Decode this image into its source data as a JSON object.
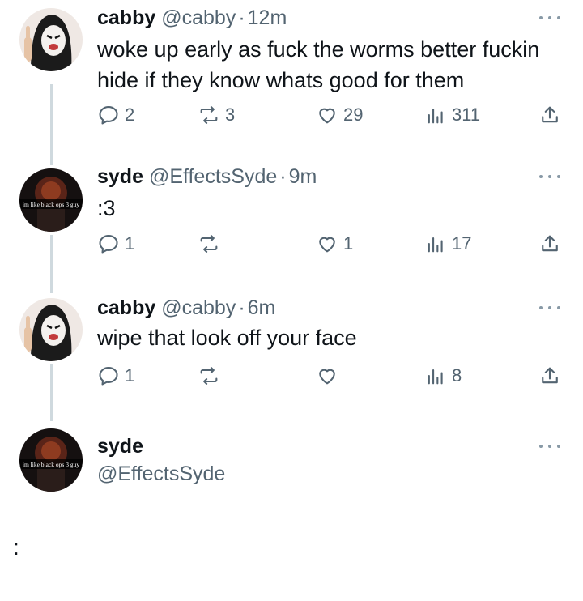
{
  "posts": [
    {
      "name": "cabby",
      "handle": "@cabby",
      "separator": "·",
      "time": "12m",
      "text": "woke up early as fuck the worms better fuckin hide if they know whats good for them",
      "replies": "2",
      "reposts": "3",
      "likes": "29",
      "views": "311",
      "avatar": "masked-figure-avatar"
    },
    {
      "name": "syde",
      "handle": "@EffectsSyde",
      "separator": "·",
      "time": "9m",
      "text": ":3",
      "replies": "1",
      "reposts": "",
      "likes": "1",
      "views": "17",
      "avatar": "black-ops-avatar",
      "avatar_caption": "im like black ops 3 guy"
    },
    {
      "name": "cabby",
      "handle": "@cabby",
      "separator": "·",
      "time": "6m",
      "text": "wipe that look off your face",
      "replies": "1",
      "reposts": "",
      "likes": "",
      "views": "8",
      "avatar": "masked-figure-avatar"
    }
  ],
  "composer": {
    "name": "syde",
    "handle": "@EffectsSyde",
    "avatar": "black-ops-avatar",
    "avatar_caption": "im like black ops 3 guy"
  },
  "footer_mark": ":",
  "colors": {
    "text": "#0f1419",
    "secondary": "#536471",
    "thread_line": "#cfd9de"
  }
}
